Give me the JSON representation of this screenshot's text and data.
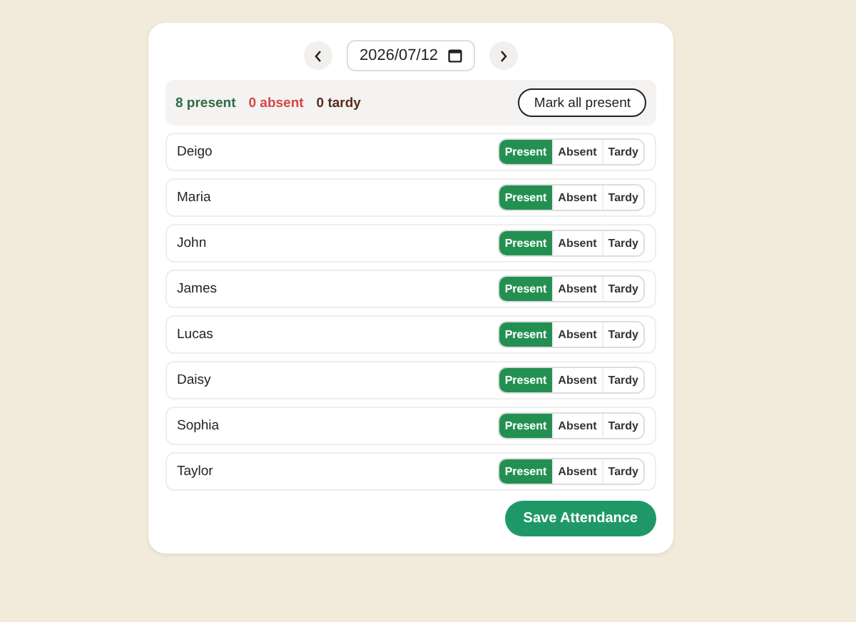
{
  "date": {
    "value": "2026/07/12"
  },
  "summary": {
    "present": "8 present",
    "absent": "0 absent",
    "tardy": "0 tardy"
  },
  "mark_all_button": "Mark all present",
  "students": [
    {
      "name": "Deigo",
      "options": [
        {
          "label": "Present",
          "selected": true
        },
        {
          "label": "Absent",
          "selected": false
        },
        {
          "label": "Tardy",
          "selected": false
        }
      ]
    },
    {
      "name": "Maria",
      "options": [
        {
          "label": "Present",
          "selected": true
        },
        {
          "label": "Absent",
          "selected": false
        },
        {
          "label": "Tardy",
          "selected": false
        }
      ]
    },
    {
      "name": "John",
      "options": [
        {
          "label": "Present",
          "selected": true
        },
        {
          "label": "Absent",
          "selected": false
        },
        {
          "label": "Tardy",
          "selected": false
        }
      ]
    },
    {
      "name": "James",
      "options": [
        {
          "label": "Present",
          "selected": true
        },
        {
          "label": "Absent",
          "selected": false
        },
        {
          "label": "Tardy",
          "selected": false
        }
      ]
    },
    {
      "name": "Lucas",
      "options": [
        {
          "label": "Present",
          "selected": true
        },
        {
          "label": "Absent",
          "selected": false
        },
        {
          "label": "Tardy",
          "selected": false
        }
      ]
    },
    {
      "name": "Daisy",
      "options": [
        {
          "label": "Present",
          "selected": true
        },
        {
          "label": "Absent",
          "selected": false
        },
        {
          "label": "Tardy",
          "selected": false
        }
      ]
    },
    {
      "name": "Sophia",
      "options": [
        {
          "label": "Present",
          "selected": true
        },
        {
          "label": "Absent",
          "selected": false
        },
        {
          "label": "Tardy",
          "selected": false
        }
      ]
    },
    {
      "name": "Taylor",
      "options": [
        {
          "label": "Present",
          "selected": true
        },
        {
          "label": "Absent",
          "selected": false
        },
        {
          "label": "Tardy",
          "selected": false
        }
      ]
    }
  ],
  "save_button": "Save Attendance"
}
